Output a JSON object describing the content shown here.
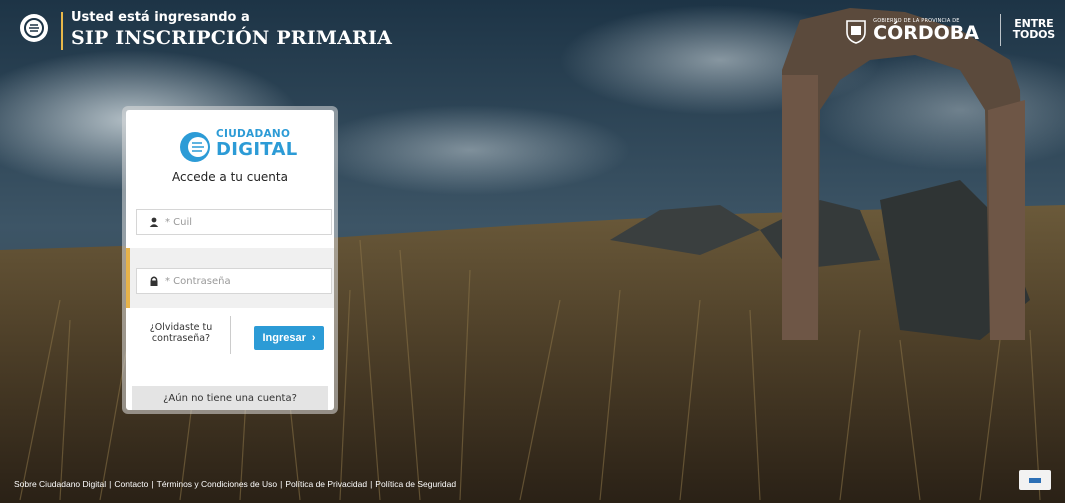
{
  "header": {
    "subtitle": "Usted está ingresando a",
    "title": "SIP INSCRIPCIÓN PRIMARIA",
    "gov_small": "GOBIERNO DE LA PROVINCIA DE",
    "gov_name": "CÓRDOBA",
    "slogan_line1": "ENTRE",
    "slogan_line2": "TODOS"
  },
  "login": {
    "brand_line1": "CIUDADANO",
    "brand_line2": "DIGITAL",
    "heading": "Accede a tu cuenta",
    "cuil_placeholder": "* Cuil",
    "password_placeholder": "* Contraseña",
    "forgot_line1": "¿Olvidaste tu",
    "forgot_line2": "contraseña?",
    "submit_label": "Ingresar",
    "register_label": "¿Aún no tiene una cuenta?"
  },
  "footer": {
    "links": [
      "Sobre Ciudadano Digital",
      "Contacto",
      "Términos y Condiciones de Uso",
      "Política de Privacidad",
      "Política de Seguridad"
    ]
  },
  "colors": {
    "accent": "#2c9bd6",
    "gold": "#e6b24a"
  },
  "icons": {
    "cuil": "user-icon",
    "password": "lock-icon",
    "submit": "chevron-right-icon"
  }
}
